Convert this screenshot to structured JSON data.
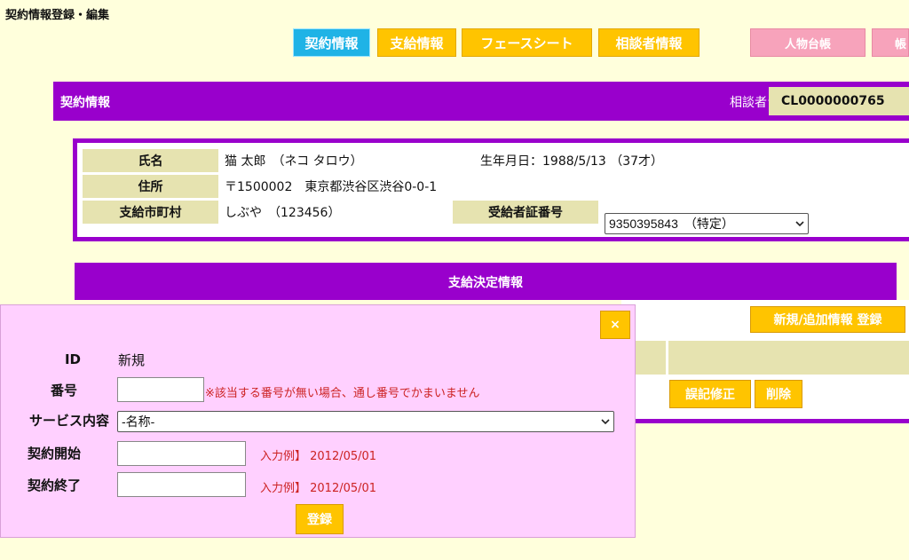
{
  "page_title": "契約情報登録・編集",
  "tabs": {
    "contract": "契約情報",
    "payment": "支給情報",
    "facesheet": "フェースシート",
    "consultant": "相談者情報",
    "person_ledger": "人物台帳",
    "extra": "帳"
  },
  "contract_bar": {
    "title": "契約情報",
    "ledger_label": "相談者台帳",
    "ledger_id": "CL0000000765"
  },
  "person": {
    "name_label": "氏名",
    "name_value": "猫 太郎　（ネコ タロウ）",
    "birth_value": "生年月日：1988/5/13 （37才）",
    "address_label": "住所",
    "address_value": "〒1500002　東京都渋谷区渋谷0-0-1",
    "city_label": "支給市町村",
    "city_value": "しぶや　（123456）",
    "cert_label": "受給者証番号",
    "cert_value": "9350395843　（特定）"
  },
  "decision": {
    "title": "支給決定情報",
    "add_button": "新規/追加情報 登録",
    "correct_button": "誤記修正",
    "delete_button": "削除"
  },
  "modal": {
    "close": "×",
    "id_label": "ID",
    "id_value": "新規",
    "number_label": "番号",
    "number_value": "",
    "number_note": "※該当する番号が無い場合、通し番号でかまいません",
    "service_label": "サービス内容",
    "service_value": "-名称-",
    "start_label": "契約開始",
    "start_value": "",
    "start_hint": "入力例】 2012/05/01",
    "end_label": "契約終了",
    "end_value": "",
    "end_hint": "入力例】 2012/05/01",
    "submit": "登録"
  },
  "colors": {
    "background": "#ffffdc",
    "purple": "#9900cc",
    "label_bg": "#e6e3b0",
    "yellow_button": "#ffc400",
    "cyan_tab": "#1fb3e6",
    "pink_tab": "#f7a3bb",
    "modal_bg": "#ffd0ff"
  },
  "icons": {
    "dropdown": "chevron-down-icon",
    "close": "close-icon"
  }
}
